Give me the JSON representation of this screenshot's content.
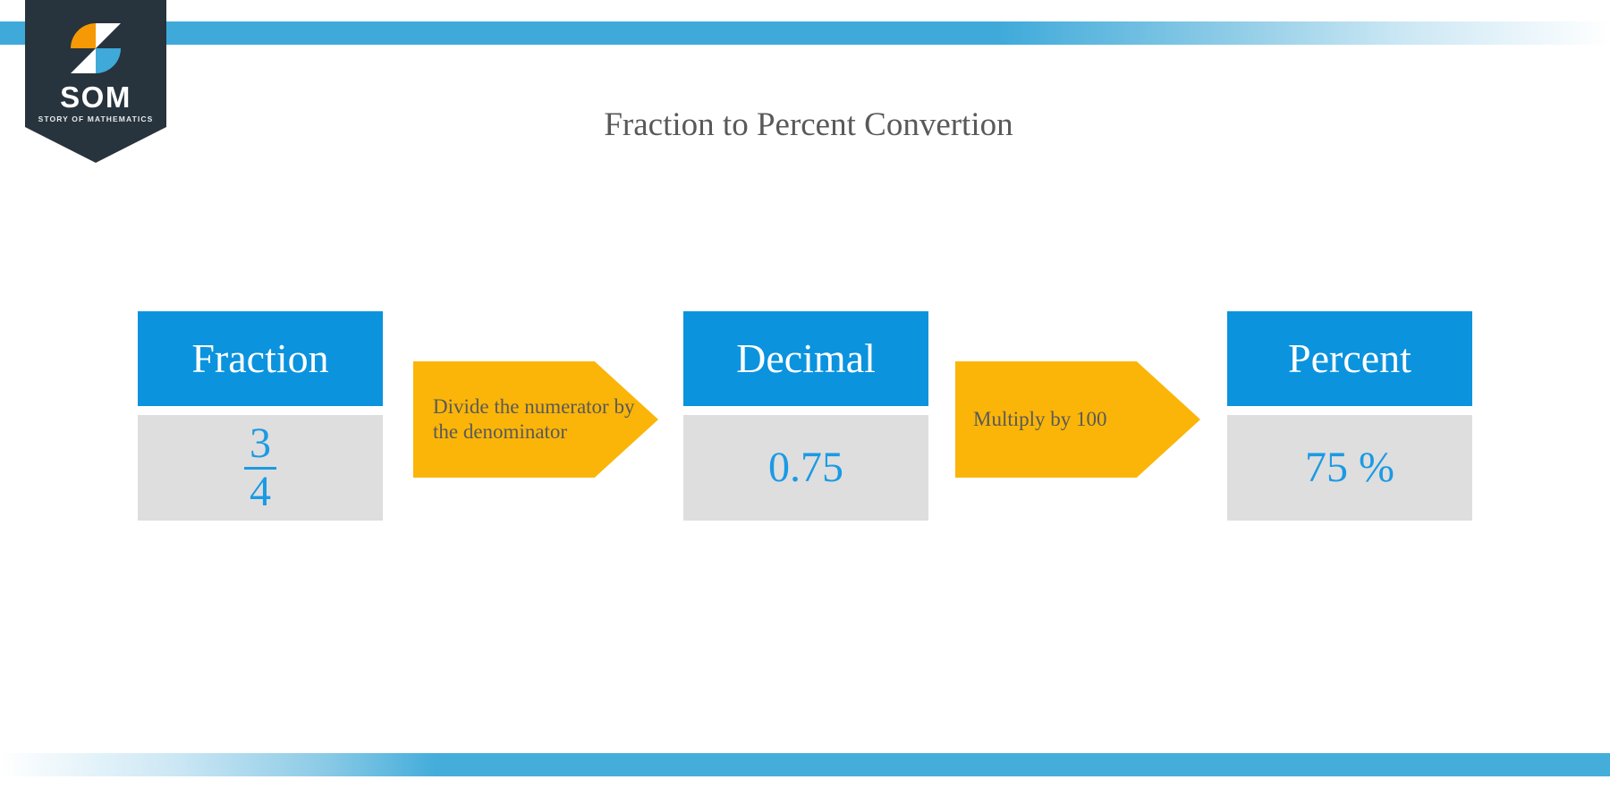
{
  "slide": {
    "title": "Fraction to Percent Convertion",
    "background_color": "#ffffff"
  },
  "logo": {
    "wordmark": "SOM",
    "tagline": "STORY OF MATHEMATICS",
    "badge_color": "#27333d",
    "mark_orange": "#f59a04",
    "mark_blue": "#3faada",
    "mark_white": "#ffffff"
  },
  "decor": {
    "accent_blue": "#3faada",
    "top_bar_color": "#3faada",
    "bottom_bar_color": "#44adda"
  },
  "theme": {
    "header_blue": "#0b93de",
    "value_gray": "#dedede",
    "value_blue": "#1b9ae4",
    "arrow_amber": "#fbb508",
    "text_gray": "#595959"
  },
  "chart_data": {
    "type": "diagram",
    "title": "Fraction to Percent Convertion",
    "flow": [
      {
        "label": "Fraction",
        "value": "3/4",
        "numerator": "3",
        "denominator": "4"
      },
      {
        "label": "Decimal",
        "value": "0.75"
      },
      {
        "label": "Percent",
        "value": "75 %"
      }
    ],
    "transitions": [
      {
        "from": "Fraction",
        "to": "Decimal",
        "label": "Divide the numerator by the denominator"
      },
      {
        "from": "Decimal",
        "to": "Percent",
        "label": "Multiply by 100"
      }
    ]
  },
  "flow": {
    "stages": [
      {
        "label": "Fraction",
        "numerator": "3",
        "denominator": "4"
      },
      {
        "label": "Decimal",
        "value": "0.75"
      },
      {
        "label": "Percent",
        "value": "75 %"
      }
    ],
    "arrows": [
      {
        "label": "Divide the numerator by the denominator"
      },
      {
        "label": "Multiply by 100"
      }
    ]
  }
}
